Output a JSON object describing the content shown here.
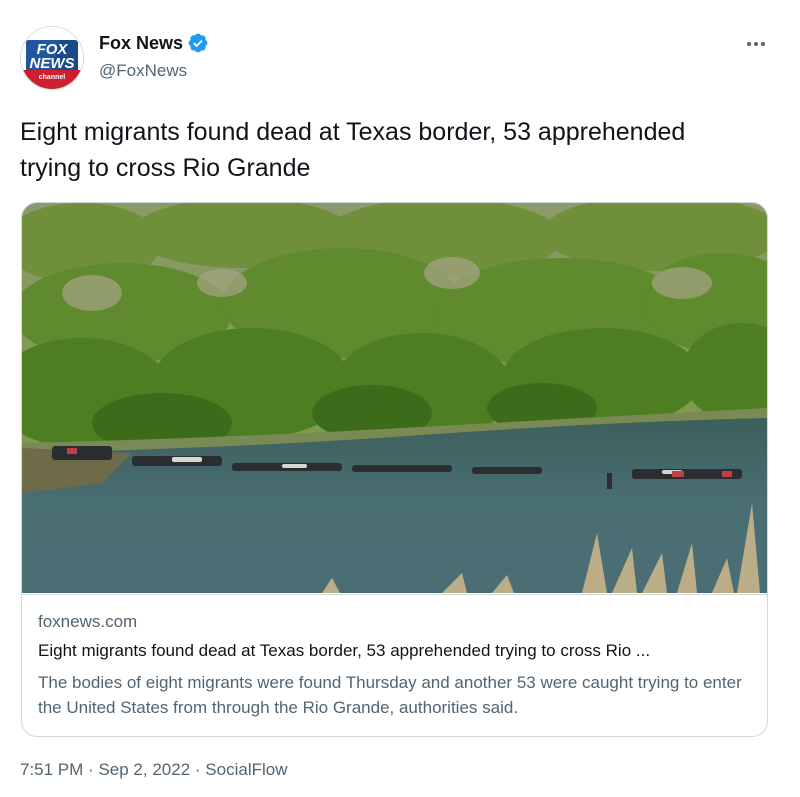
{
  "author": {
    "display_name": "Fox News",
    "handle": "@FoxNews",
    "verified": true,
    "logo": {
      "line1": "FOX",
      "line2": "NEWS",
      "line3": "channel"
    }
  },
  "tweet": {
    "text": "Eight migrants found dead at Texas border, 53 apprehended trying to cross Rio Grande"
  },
  "card": {
    "domain": "foxnews.com",
    "title": "Eight migrants found dead at Texas border, 53 apprehended trying to cross Rio ...",
    "description": "The bodies of eight migrants were found Thursday and another 53 were caught trying to enter the United States from through the Rio Grande, authorities said."
  },
  "meta": {
    "time": "7:51 PM",
    "separator": "·",
    "date": "Sep 2, 2022",
    "source": "SocialFlow"
  },
  "icons": {
    "verified": "verified-badge-icon",
    "more": "more-options-icon"
  },
  "colors": {
    "verified_blue": "#1d9bf0",
    "secondary_text": "#536471",
    "primary_text": "#0f1419",
    "border": "#cfd9de",
    "logo_blue": "#1a4a8a",
    "logo_red": "#cc1f2f"
  }
}
